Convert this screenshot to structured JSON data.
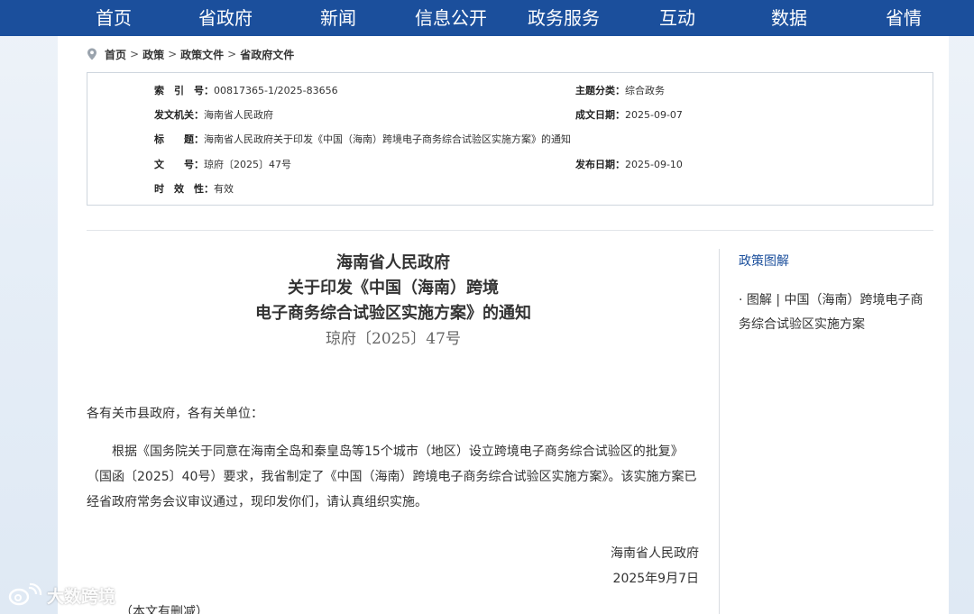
{
  "nav": {
    "items": [
      "首页",
      "省政府",
      "新闻",
      "信息公开",
      "政务服务",
      "互动",
      "数据",
      "省情"
    ]
  },
  "breadcrumb": {
    "items": [
      "首页",
      "政策",
      "政策文件",
      "省政府文件"
    ],
    "separator": ">"
  },
  "info": {
    "index_label": "索　引　号：",
    "index_value": "00817365-1/2025-83656",
    "category_label": "主题分类：",
    "category_value": "综合政务",
    "issuer_label": "发文机关：",
    "issuer_value": "海南省人民政府",
    "created_label": "成文日期：",
    "created_value": "2025-09-07",
    "title_label": "标　　题：",
    "title_value": "海南省人民政府关于印发《中国（海南）跨境电子商务综合试验区实施方案》的通知",
    "docno_label": "文　　号：",
    "docno_value": "琼府〔2025〕47号",
    "published_label": "发布日期：",
    "published_value": "2025-09-10",
    "validity_label": "时　效　性：",
    "validity_value": "有效"
  },
  "document": {
    "title_line1": "海南省人民政府",
    "title_line2": "关于印发《中国（海南）跨境",
    "title_line3": "电子商务综合试验区实施方案》的通知",
    "number": "琼府〔2025〕47号",
    "salutation": "各有关市县政府，各有关单位：",
    "paragraph": "根据《国务院关于同意在海南全岛和秦皇岛等15个城市（地区）设立跨境电子商务综合试验区的批复》（国函〔2025〕40号）要求，我省制定了《中国（海南）跨境电子商务综合试验区实施方案》。该实施方案已经省政府常务会议审议通过，现印发你们，请认真组织实施。",
    "signer": "海南省人民政府",
    "date": "2025年9月7日",
    "note": "（本文有删减）"
  },
  "sidebar": {
    "title": "政策图解",
    "link": "· 图解 | 中国（海南）跨境电子商务综合试验区实施方案"
  },
  "watermark": {
    "text": "大数跨境"
  },
  "colors": {
    "nav_bg": "#1b4f9c",
    "link": "#1b4f9c"
  }
}
